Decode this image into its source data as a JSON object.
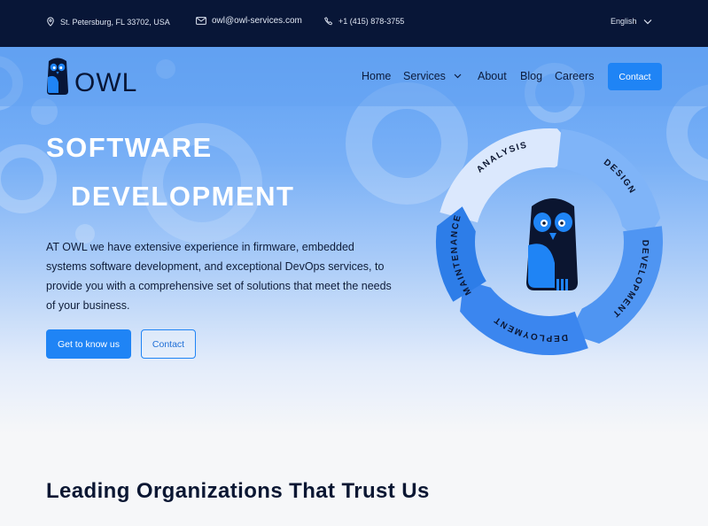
{
  "topbar": {
    "address": "St. Petersburg, FL 33702, USA",
    "email": "owl@owl-services.com",
    "phone": "+1 (415) 878-3755",
    "language": "English"
  },
  "logo": {
    "text": "OWL"
  },
  "nav": {
    "items": [
      "Home",
      "Services",
      "About",
      "Blog",
      "Careers"
    ],
    "contact": "Contact"
  },
  "hero": {
    "title_line1": "SOFTWARE",
    "title_line2": "DEVELOPMENT",
    "description": "AT OWL we have extensive experience in firmware, embedded systems software development, and exceptional DevOps services, to provide you with a comprehensive set of solutions that meet the needs of your business.",
    "primary_button": "Get to know us",
    "secondary_button": "Contact"
  },
  "cycle": {
    "stages": [
      "ANALYSIS",
      "DESIGN",
      "DEVELOPMENT",
      "DEPLOYMENT",
      "MAINTENANCE"
    ]
  },
  "trust": {
    "heading": "Leading Organizations That Trust Us"
  },
  "colors": {
    "topbar_bg": "#081637",
    "accent": "#1f84f5",
    "owl_dark": "#081637",
    "owl_blue": "#1f84f5"
  }
}
